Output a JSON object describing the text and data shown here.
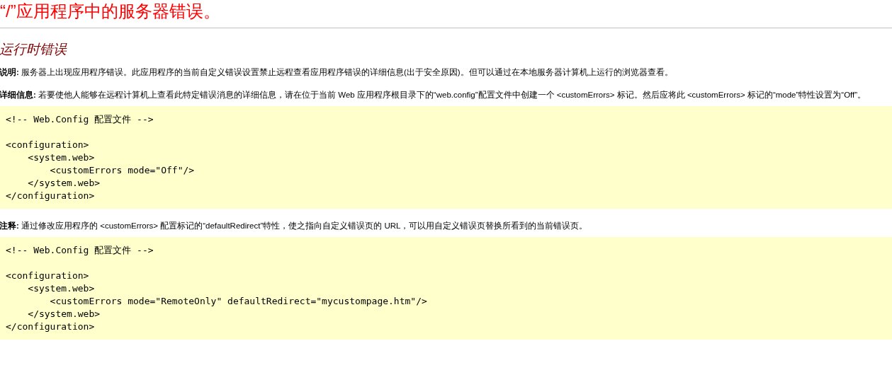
{
  "title": "“/”应用程序中的服务器错误。",
  "subtitle": "运行时错误",
  "sections": [
    {
      "kind": "paragraph",
      "text": "**说明:** 服务器上出现应用程序错误。此应用程序的当前自定义错误设置禁止远程查看应用程序错误的详细信息(出于安全原因)。但可以通过在本地服务器计算机上运行的浏览器查看。"
    },
    {
      "kind": "paragraph",
      "text": "**详细信息:** 若要使他人能够在远程计算机上查看此特定错误消息的详细信息，请在位于当前 Web 应用程序根目录下的“web.config”配置文件中创建一个 <customErrors> 标记。然后应将此 <customErrors> 标记的“mode”特性设置为“Off”。"
    },
    {
      "kind": "code",
      "text": "<!-- Web.Config 配置文件 -->\n\n<configuration>\n    <system.web>\n        <customErrors mode=\"Off\"/>\n    </system.web>\n</configuration>"
    },
    {
      "kind": "paragraph",
      "text": "**注释:** 通过修改应用程序的 <customErrors> 配置标记的“defaultRedirect”特性，使之指向自定义错误页的 URL，可以用自定义错误页替换所看到的当前错误页。"
    },
    {
      "kind": "code",
      "text": "<!-- Web.Config 配置文件 -->\n\n<configuration>\n    <system.web>\n        <customErrors mode=\"RemoteOnly\" defaultRedirect=\"mycustompage.htm\"/>\n    </system.web>\n</configuration>"
    }
  ]
}
